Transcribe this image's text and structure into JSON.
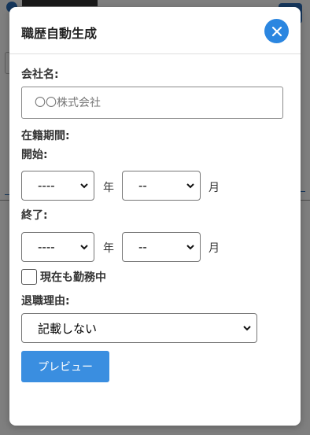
{
  "modal": {
    "title": "職歴自動生成",
    "close_icon": "close-icon"
  },
  "company": {
    "label": "会社名:",
    "value": "",
    "placeholder": "〇〇株式会社"
  },
  "period": {
    "label": "在籍期間:",
    "start": {
      "label": "開始:",
      "year_value": "----",
      "year_unit": "年",
      "month_value": "--",
      "month_unit": "月"
    },
    "end": {
      "label": "終了:",
      "year_value": "----",
      "year_unit": "年",
      "month_value": "--",
      "month_unit": "月"
    },
    "current_checkbox": {
      "label": "現在も勤務中",
      "checked": false
    }
  },
  "retirement": {
    "label": "退職理由:",
    "value": "記載しない"
  },
  "preview_button": {
    "label": "プレビュー"
  },
  "colors": {
    "accent": "#2b86e0",
    "button": "#3a8ee0"
  }
}
